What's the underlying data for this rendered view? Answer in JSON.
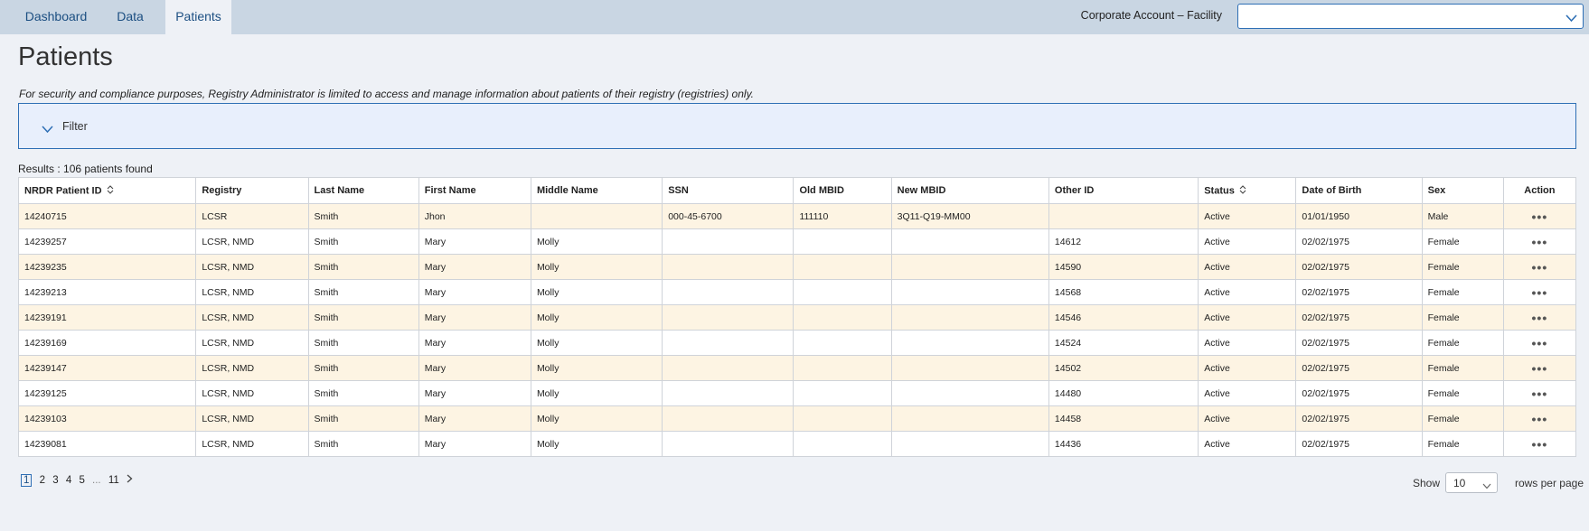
{
  "nav": {
    "tabs": [
      {
        "label": "Dashboard",
        "active": false
      },
      {
        "label": "Data",
        "active": false
      },
      {
        "label": "Patients",
        "active": true
      }
    ],
    "facility_label": "Corporate Account – Facility",
    "facility_value": ""
  },
  "page": {
    "title": "Patients",
    "notice": "For security and compliance purposes, Registry Administrator is limited to access and manage information about patients of their registry (registries) only."
  },
  "filter": {
    "label": "Filter",
    "icon": "chevron-down-icon"
  },
  "results": {
    "text": "Results : 106 patients found"
  },
  "table": {
    "columns": [
      "NRDR Patient ID",
      "Registry",
      "Last Name",
      "First Name",
      "Middle Name",
      "SSN",
      "Old MBID",
      "New MBID",
      "Other ID",
      "Status",
      "Date of Birth",
      "Sex",
      "Action"
    ],
    "sortable_columns": [
      "NRDR Patient ID",
      "Status"
    ],
    "action_icon": "more-horizontal-icon",
    "rows": [
      [
        "14240715",
        "LCSR",
        "Smith",
        "Jhon",
        "",
        "000-45-6700",
        "111110",
        "3Q11-Q19-MM00",
        "",
        "Active",
        "01/01/1950",
        "Male"
      ],
      [
        "14239257",
        "LCSR, NMD",
        "Smith",
        "Mary",
        "Molly",
        "",
        "",
        "",
        "14612",
        "Active",
        "02/02/1975",
        "Female"
      ],
      [
        "14239235",
        "LCSR, NMD",
        "Smith",
        "Mary",
        "Molly",
        "",
        "",
        "",
        "14590",
        "Active",
        "02/02/1975",
        "Female"
      ],
      [
        "14239213",
        "LCSR, NMD",
        "Smith",
        "Mary",
        "Molly",
        "",
        "",
        "",
        "14568",
        "Active",
        "02/02/1975",
        "Female"
      ],
      [
        "14239191",
        "LCSR, NMD",
        "Smith",
        "Mary",
        "Molly",
        "",
        "",
        "",
        "14546",
        "Active",
        "02/02/1975",
        "Female"
      ],
      [
        "14239169",
        "LCSR, NMD",
        "Smith",
        "Mary",
        "Molly",
        "",
        "",
        "",
        "14524",
        "Active",
        "02/02/1975",
        "Female"
      ],
      [
        "14239147",
        "LCSR, NMD",
        "Smith",
        "Mary",
        "Molly",
        "",
        "",
        "",
        "14502",
        "Active",
        "02/02/1975",
        "Female"
      ],
      [
        "14239125",
        "LCSR, NMD",
        "Smith",
        "Mary",
        "Molly",
        "",
        "",
        "",
        "14480",
        "Active",
        "02/02/1975",
        "Female"
      ],
      [
        "14239103",
        "LCSR, NMD",
        "Smith",
        "Mary",
        "Molly",
        "",
        "",
        "",
        "14458",
        "Active",
        "02/02/1975",
        "Female"
      ],
      [
        "14239081",
        "LCSR, NMD",
        "Smith",
        "Mary",
        "Molly",
        "",
        "",
        "",
        "14436",
        "Active",
        "02/02/1975",
        "Female"
      ]
    ]
  },
  "pagination": {
    "pages": [
      "1",
      "2",
      "3",
      "4",
      "5",
      "...",
      "11"
    ],
    "current": "1",
    "next_icon": "chevron-right-icon",
    "show_label": "Show",
    "rows_per_page_value": "10",
    "rows_per_page_suffix": "rows per page"
  },
  "colors": {
    "topbar": "#c9d6e3",
    "accent": "#2e6fb5",
    "link": "#1c4f82",
    "row_alt": "#fdf4e3",
    "filter_bg": "#e8effc"
  }
}
